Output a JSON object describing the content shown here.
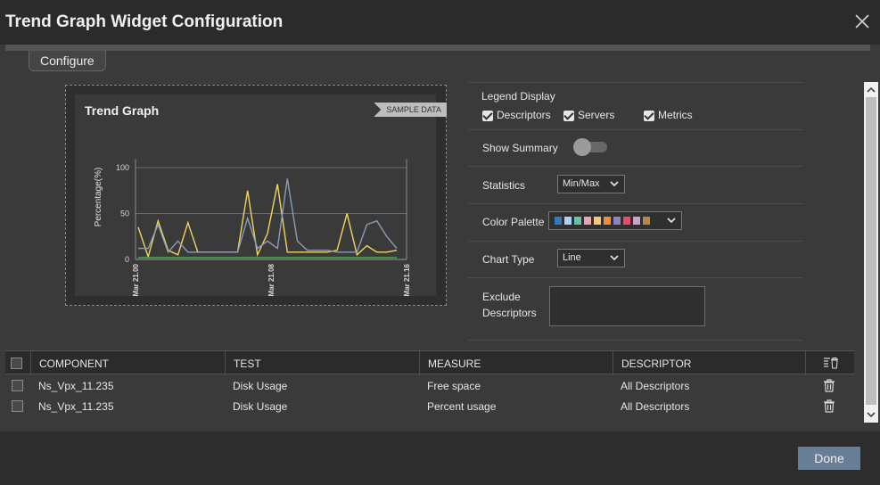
{
  "window": {
    "title": "Trend Graph Widget Configuration"
  },
  "tabs": [
    {
      "label": "Configure"
    }
  ],
  "preview": {
    "title": "Trend Graph",
    "badge": "SAMPLE DATA",
    "chart_data": {
      "type": "line",
      "ylabel": "Percentage(%)",
      "xlabel": "",
      "ylim": [
        0,
        100
      ],
      "y_ticks": [
        "100",
        "50",
        "0"
      ],
      "x_ticks": [
        "Mar 21.00",
        "Mar 21.08",
        "Mar 21.16"
      ],
      "grid": true,
      "series": [
        {
          "color": "#f2d65c",
          "values": [
            35,
            3,
            42,
            10,
            5,
            40,
            8,
            8,
            8,
            8,
            8,
            75,
            5,
            28,
            82,
            8,
            8,
            8,
            8,
            8,
            10,
            50,
            5,
            15,
            8,
            8,
            10
          ]
        },
        {
          "color": "#8a9db7",
          "values": [
            12,
            12,
            38,
            8,
            20,
            8,
            8,
            8,
            8,
            8,
            8,
            45,
            12,
            20,
            12,
            88,
            20,
            10,
            10,
            10,
            8,
            8,
            8,
            38,
            42,
            25,
            12
          ]
        },
        {
          "color": "#4caf50",
          "values": [
            2,
            2,
            2,
            2,
            2,
            2,
            2,
            2,
            2,
            2,
            2,
            2,
            2,
            2,
            2,
            2,
            2,
            2,
            2,
            2,
            2,
            2,
            2,
            2,
            2,
            2,
            2
          ]
        }
      ]
    }
  },
  "settings": {
    "legend_display": {
      "label": "Legend Display",
      "options": [
        {
          "label": "Descriptors",
          "checked": true
        },
        {
          "label": "Servers",
          "checked": true
        },
        {
          "label": "Metrics",
          "checked": true
        }
      ]
    },
    "show_summary": {
      "label": "Show Summary",
      "on": false
    },
    "statistics": {
      "label": "Statistics",
      "value": "Min/Max"
    },
    "color_palette": {
      "label": "Color Palette",
      "swatches": [
        "#2e7bbf",
        "#a9d3f5",
        "#66c2a5",
        "#e8a5b5",
        "#f5c77e",
        "#ee8e3c",
        "#8c84c6",
        "#e64c6b",
        "#c9a2c9",
        "#b3874d"
      ]
    },
    "chart_type": {
      "label": "Chart Type",
      "value": "Line"
    },
    "exclude_descriptors": {
      "label_line1": "Exclude",
      "label_line2": "Descriptors",
      "value": ""
    }
  },
  "table": {
    "columns": [
      "COMPONENT",
      "TEST",
      "MEASURE",
      "DESCRIPTOR"
    ],
    "rows": [
      {
        "component": "Ns_Vpx_11.235",
        "test": "Disk Usage",
        "measure": "Free space",
        "descriptor": "All Descriptors"
      },
      {
        "component": "Ns_Vpx_11.235",
        "test": "Disk Usage",
        "measure": "Percent usage",
        "descriptor": "All Descriptors"
      }
    ]
  },
  "footer": {
    "done_label": "Done"
  }
}
